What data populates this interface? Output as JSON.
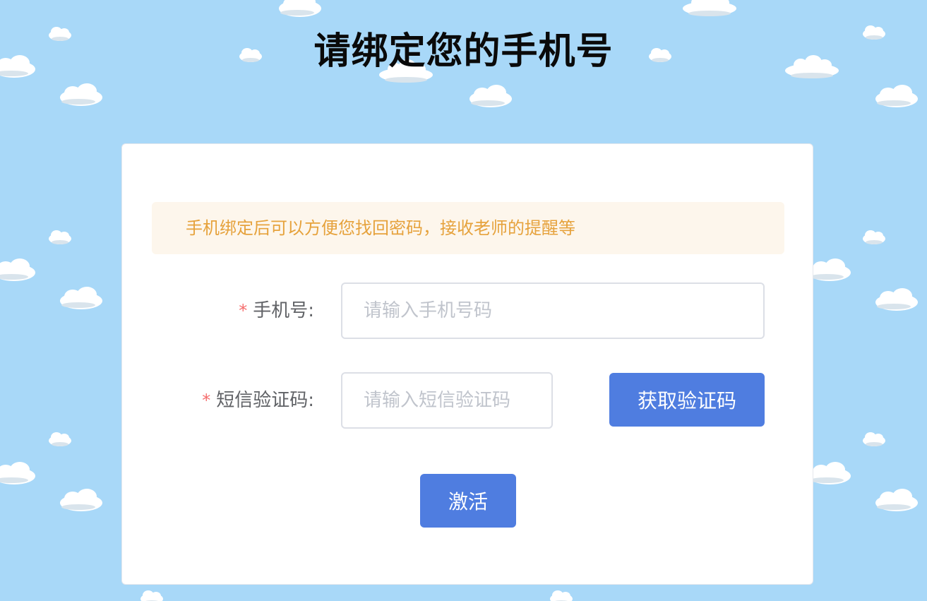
{
  "page": {
    "title": "请绑定您的手机号"
  },
  "notice": {
    "text": "手机绑定后可以方便您找回密码，接收老师的提醒等"
  },
  "form": {
    "required_mark": "*",
    "phone": {
      "label": "手机号:",
      "value": "",
      "placeholder": "请输入手机号码"
    },
    "sms_code": {
      "label": "短信验证码:",
      "value": "",
      "placeholder": "请输入短信验证码"
    },
    "send_code_label": "获取验证码",
    "activate_label": "激活"
  },
  "colors": {
    "background": "#a8d8f8",
    "primary_button": "#4f7de0",
    "notice_bg": "#fdf6ec",
    "notice_text": "#e6a23c",
    "required": "#f56c6c"
  }
}
